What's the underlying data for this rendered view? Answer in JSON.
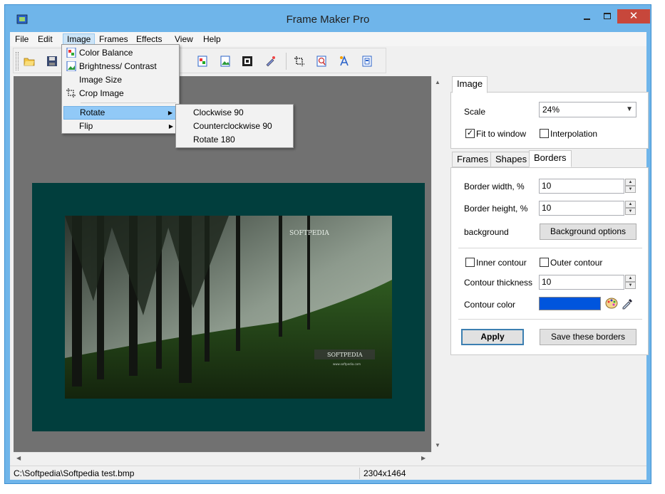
{
  "window": {
    "title": "Frame Maker Pro",
    "close_glyph": "✕"
  },
  "menubar": {
    "items": [
      "File",
      "Edit",
      "Image",
      "Frames",
      "Effects",
      "View",
      "Help"
    ],
    "active": "Image"
  },
  "image_menu": {
    "items": [
      {
        "label": "Color Balance",
        "icon": "color-balance-icon"
      },
      {
        "label": "Brightness/ Contrast",
        "icon": "brightness-contrast-icon"
      },
      {
        "label": "Image Size",
        "icon": ""
      },
      {
        "label": "Crop Image",
        "icon": "crop-icon"
      },
      {
        "label": "Rotate",
        "submenu": true,
        "highlighted": true
      },
      {
        "label": "Flip",
        "submenu": true
      }
    ]
  },
  "rotate_submenu": {
    "items": [
      "Clockwise 90",
      "Counterclockwise 90",
      "Rotate 180"
    ]
  },
  "photo": {
    "watermark_top": "SOFTPEDIA",
    "watermark_bottom": "SOFTPEDIA",
    "watermark_small": "www.softpedia.com"
  },
  "statusbar": {
    "path": "C:\\Softpedia\\Softpedia test.bmp",
    "dimensions": "2304x1464"
  },
  "image_panel": {
    "tab": "Image",
    "scale_label": "Scale",
    "scale_value": "24%",
    "fit_to_window_label": "Fit to window",
    "fit_to_window_checked": true,
    "interpolation_label": "Interpolation",
    "interpolation_checked": false
  },
  "borders_panel": {
    "tabs": [
      "Frames",
      "Shapes",
      "Borders"
    ],
    "active_tab": "Borders",
    "border_width_label": "Border width, %",
    "border_width_value": "10",
    "border_height_label": "Border height, %",
    "border_height_value": "10",
    "background_label": "background",
    "background_button": "Background options",
    "inner_contour_label": "Inner contour",
    "outer_contour_label": "Outer contour",
    "contour_thickness_label": "Contour thickness",
    "contour_thickness_value": "10",
    "contour_color_label": "Contour color",
    "contour_color": "#0055dd",
    "apply_button": "Apply",
    "save_button": "Save these borders"
  },
  "colors": {
    "frame_border": "#013e3d",
    "canvas_bg": "#717171",
    "titlebar": "#6fb5ea",
    "menu_highlight": "#91c9f7"
  }
}
